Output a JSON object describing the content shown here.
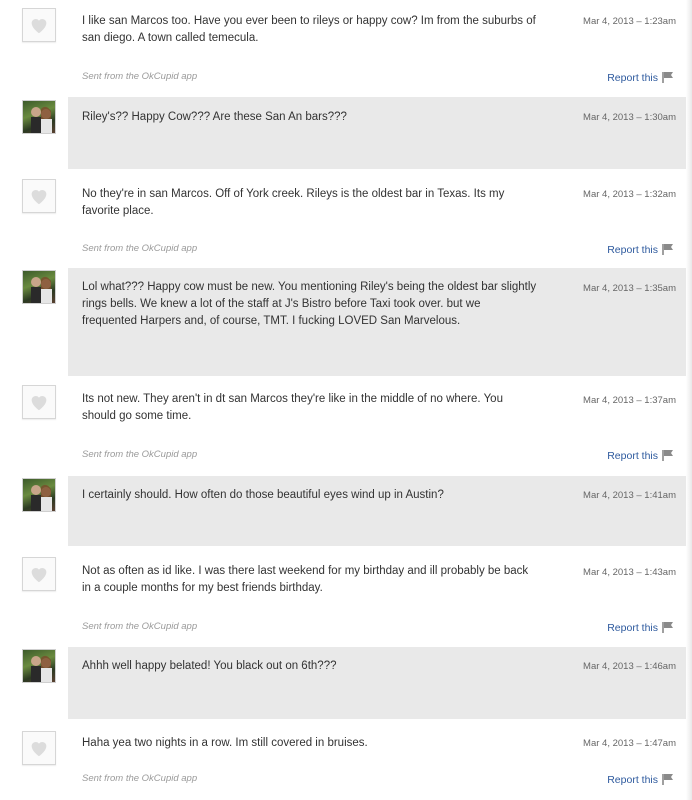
{
  "thread": {
    "sent_label": "Sent from the OkCupid app",
    "report_label": "Report this",
    "messages": [
      {
        "sender": "them",
        "text": "I like san Marcos too. Have you ever been to rileys or happy cow? Im from the suburbs of san diego. A town called temecula.",
        "timestamp": "Mar 4, 2013 – 1:23am"
      },
      {
        "sender": "me",
        "text": "Riley's?? Happy Cow??? Are these San An bars???",
        "timestamp": "Mar 4, 2013 – 1:30am"
      },
      {
        "sender": "them",
        "text": "No they're in san Marcos. Off of York creek. Rileys is the oldest bar in Texas. Its my favorite place.",
        "timestamp": "Mar 4, 2013 – 1:32am"
      },
      {
        "sender": "me",
        "text": "Lol what??? Happy cow must be new. You mentioning Riley's being the oldest bar slightly rings bells. We knew a lot of the staff at J's Bistro before Taxi took over. but we frequented Harpers and, of course, TMT. I fucking LOVED San Marvelous.",
        "timestamp": "Mar 4, 2013 – 1:35am"
      },
      {
        "sender": "them",
        "text": "Its not new. They aren't in dt san Marcos they're like in the middle of no where. You should go some time.",
        "timestamp": "Mar 4, 2013 – 1:37am"
      },
      {
        "sender": "me",
        "text": "I certainly should. How often do those beautiful eyes wind up in Austin?",
        "timestamp": "Mar 4, 2013 – 1:41am"
      },
      {
        "sender": "them",
        "text": "Not as often as id like. I was there last weekend for my birthday and ill probably be back in a couple months for my best friends birthday.",
        "timestamp": "Mar 4, 2013 – 1:43am"
      },
      {
        "sender": "me",
        "text": "Ahhh well happy belated! You black out on 6th???",
        "timestamp": "Mar 4, 2013 – 1:46am"
      },
      {
        "sender": "them",
        "text": "Haha yea two nights in a row. Im still covered in bruises.",
        "timestamp": "Mar 4, 2013 – 1:47am"
      }
    ]
  },
  "icons": {
    "placeholder_avatar": "heart-icon",
    "report": "flag-icon"
  },
  "colors": {
    "mine_bg": "#e9e9e9",
    "theirs_bg": "#ffffff",
    "link": "#2e5a9e",
    "text": "#333333",
    "meta": "#9a9a9a"
  }
}
